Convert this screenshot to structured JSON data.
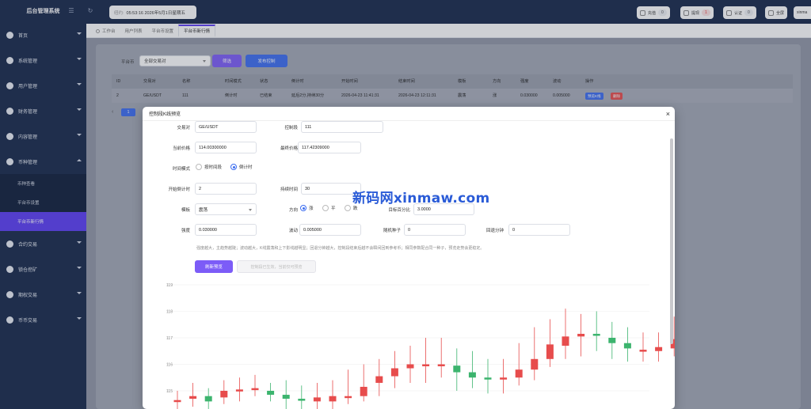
{
  "app": {
    "title": "后台管理系统"
  },
  "header": {
    "time_label": "纽约:",
    "time_value": "05:53:16 2026年5月1日星期五",
    "buttons": [
      {
        "label": "充值",
        "count": "0"
      },
      {
        "label": "提现",
        "count": "1"
      },
      {
        "label": "认证",
        "count": "0"
      },
      {
        "label": "全屏"
      },
      {
        "label": "xinma"
      }
    ]
  },
  "sidebar": {
    "items": [
      {
        "label": "首页"
      },
      {
        "label": "系统管理"
      },
      {
        "label": "用户管理"
      },
      {
        "label": "财务管理"
      },
      {
        "label": "内容管理"
      },
      {
        "label": "币种管理"
      }
    ],
    "subitems": [
      {
        "label": "币种查看"
      },
      {
        "label": "平台币设置"
      },
      {
        "label": "平台币新行情"
      }
    ],
    "items_after": [
      {
        "label": "合约交易"
      },
      {
        "label": "锁仓挖矿"
      },
      {
        "label": "期权交易"
      },
      {
        "label": "币币交易"
      }
    ]
  },
  "tabs": [
    {
      "label": "工作台"
    },
    {
      "label": "用户列表"
    },
    {
      "label": "平台币设置"
    },
    {
      "label": "平台币新行情"
    }
  ],
  "filter": {
    "label": "平台币",
    "select_value": "全部交易对",
    "search_button": "筛选",
    "publish_button": "发布控制",
    "page": "1"
  },
  "table": {
    "headers": [
      "ID",
      "交易对",
      "名称",
      "时间模式",
      "状态",
      "倒计时",
      "开始时间",
      "结束时间",
      "模板",
      "方向",
      "强度",
      "波动",
      "操作"
    ],
    "row": [
      "2",
      "GE/USDT",
      "111",
      "倒计时",
      "已结束",
      "延后2分,持续30分",
      "2026-04-23 11:41:31",
      "2026-04-23 12:11:31",
      "震荡",
      "涨",
      "0.030000",
      "0.005000"
    ],
    "action_edit": "预览K线",
    "action_delete": "删除"
  },
  "dialog": {
    "title": "控制段K线预览",
    "fields": {
      "pair_label": "交易对",
      "pair_value": "GE/USDT",
      "name_label": "控制段",
      "name_value": "111",
      "price_label": "当前价格",
      "price_value": "114.00300000",
      "final_label": "最终价格",
      "final_value": "117.42309000",
      "mode_label": "时间模式",
      "mode_opt1": "按时间段",
      "mode_opt2": "倒计时",
      "start_label": "开始倒计时",
      "start_value": "2",
      "duration_label": "持续时间",
      "duration_value": "30",
      "template_label": "模板",
      "template_value": "震荡",
      "direction_label": "方向",
      "dir_up": "涨",
      "dir_flat": "平",
      "dir_down": "跌",
      "target_label": "目标百分比",
      "target_value": "3.0000",
      "strength_label": "强度",
      "strength_value": "0.030000",
      "wave_label": "波动",
      "wave_value": "0.005000",
      "seed_label": "随机种子",
      "seed_value": "0",
      "return_label": "回退分钟",
      "return_value": "0"
    },
    "hint": "强度越大，主趋势越陡；波动越大，K线震荡和上下影线越明显；回退分钟越大，控制段结束后越不会瞬间回到参考币；相同参数配合同一种子，预览走势会更稳定。",
    "preview_button": "刷新预览",
    "save_button": "控制段已生效，当前仅可预览"
  },
  "watermark": "新码网xinmaw.com",
  "chart_data": {
    "type": "candlestick",
    "y_ticks": [
      "119",
      "118",
      "117",
      "116",
      "115"
    ],
    "ylim": [
      114.7,
      119.2
    ],
    "candles": [
      {
        "o": 114.6,
        "c": 114.65,
        "h": 115.0,
        "l": 114.3
      },
      {
        "o": 114.7,
        "c": 114.8,
        "h": 115.3,
        "l": 114.4
      },
      {
        "o": 114.8,
        "c": 114.6,
        "h": 115.1,
        "l": 114.3
      },
      {
        "o": 114.75,
        "c": 115.0,
        "h": 115.4,
        "l": 114.5
      },
      {
        "o": 115.0,
        "c": 115.05,
        "h": 115.5,
        "l": 114.6
      },
      {
        "o": 115.05,
        "c": 115.1,
        "h": 115.6,
        "l": 114.8
      },
      {
        "o": 115.0,
        "c": 114.85,
        "h": 115.3,
        "l": 114.6
      },
      {
        "o": 114.85,
        "c": 114.7,
        "h": 115.4,
        "l": 114.3
      },
      {
        "o": 114.7,
        "c": 114.65,
        "h": 115.2,
        "l": 114.3
      },
      {
        "o": 114.6,
        "c": 114.75,
        "h": 115.3,
        "l": 114.3
      },
      {
        "o": 114.6,
        "c": 114.8,
        "h": 115.4,
        "l": 114.3
      },
      {
        "o": 114.8,
        "c": 114.8,
        "h": 115.8,
        "l": 114.5
      },
      {
        "o": 114.8,
        "c": 115.15,
        "h": 116.0,
        "l": 114.6
      },
      {
        "o": 115.3,
        "c": 115.55,
        "h": 116.2,
        "l": 114.8
      },
      {
        "o": 115.55,
        "c": 115.85,
        "h": 116.5,
        "l": 115.1
      },
      {
        "o": 115.85,
        "c": 116.0,
        "h": 116.7,
        "l": 115.3
      },
      {
        "o": 116.0,
        "c": 116.0,
        "h": 117.0,
        "l": 115.3
      },
      {
        "o": 116.0,
        "c": 116.0,
        "h": 117.0,
        "l": 115.5
      },
      {
        "o": 115.95,
        "c": 115.7,
        "h": 116.6,
        "l": 115.0
      },
      {
        "o": 115.7,
        "c": 115.5,
        "h": 116.5,
        "l": 115.1
      },
      {
        "o": 115.5,
        "c": 115.45,
        "h": 116.2,
        "l": 114.9
      },
      {
        "o": 115.45,
        "c": 115.5,
        "h": 116.2,
        "l": 114.9
      },
      {
        "o": 115.5,
        "c": 115.8,
        "h": 116.8,
        "l": 115.2
      },
      {
        "o": 115.8,
        "c": 116.2,
        "h": 117.4,
        "l": 115.4
      },
      {
        "o": 116.2,
        "c": 116.75,
        "h": 117.7,
        "l": 115.9
      },
      {
        "o": 116.7,
        "c": 117.05,
        "h": 118.1,
        "l": 116.2
      },
      {
        "o": 117.05,
        "c": 117.15,
        "h": 117.9,
        "l": 116.3
      },
      {
        "o": 117.15,
        "c": 117.1,
        "h": 118.0,
        "l": 116.5
      },
      {
        "o": 117.0,
        "c": 116.8,
        "h": 117.6,
        "l": 116.2
      },
      {
        "o": 116.8,
        "c": 116.6,
        "h": 117.4,
        "l": 116.1
      },
      {
        "o": 116.55,
        "c": 116.55,
        "h": 117.2,
        "l": 116.1
      },
      {
        "o": 116.5,
        "c": 116.65,
        "h": 117.2,
        "l": 116.1
      },
      {
        "o": 116.6,
        "c": 116.95,
        "h": 117.8,
        "l": 116.3
      },
      {
        "o": 116.95,
        "c": 117.4,
        "h": 118.4,
        "l": 116.8
      }
    ],
    "up_color": "#e74c4c",
    "down_color": "#3cb46e"
  }
}
